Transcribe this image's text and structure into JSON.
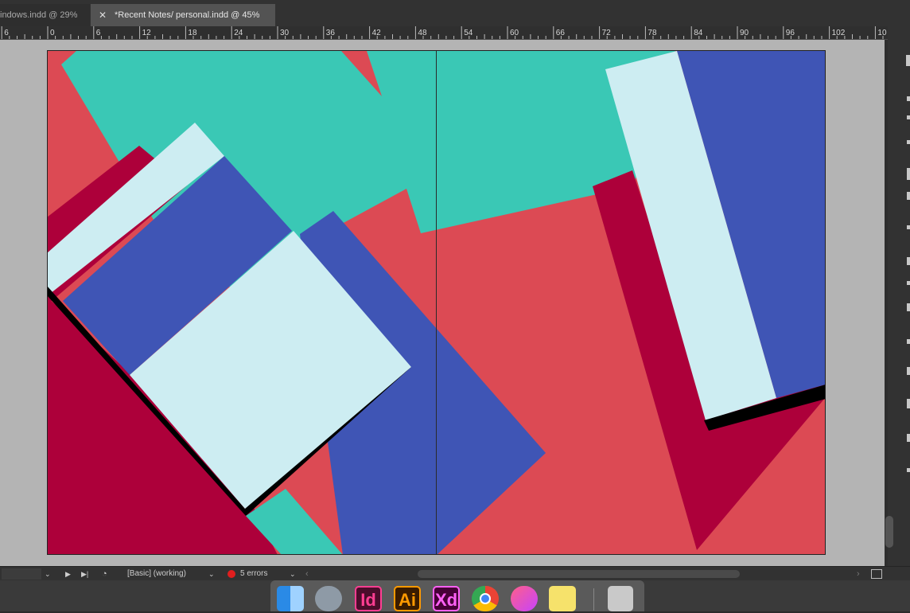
{
  "tabs": [
    {
      "label": "indows.indd @ 29%",
      "active": false
    },
    {
      "label": "*Recent Notes/ personal.indd @ 45%",
      "active": true
    }
  ],
  "ruler": {
    "labels": [
      "6",
      "0",
      "6",
      "12",
      "18",
      "24",
      "30",
      "36",
      "42",
      "48",
      "54",
      "60",
      "66",
      "72",
      "78",
      "84",
      "90",
      "96",
      "102",
      "10"
    ]
  },
  "statusbar": {
    "profile": "[Basic] (working)",
    "errors": "5 errors"
  },
  "dock": {
    "indesign": "Id",
    "illustrator": "Ai",
    "xd": "Xd"
  },
  "colors": {
    "coral": "#dc4a54",
    "teal": "#3ac8b5",
    "crimson": "#ad003a",
    "blue": "#3f55b5",
    "pale": "#cdedf2"
  }
}
